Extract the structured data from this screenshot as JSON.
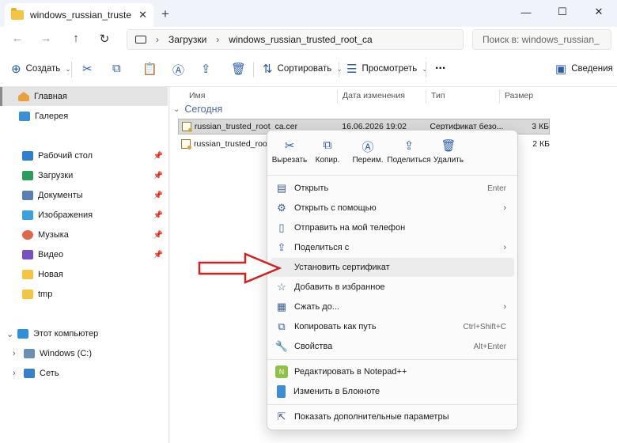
{
  "window": {
    "tab_title": "windows_russian_trusted_root_ca",
    "tab_close": "✕",
    "new_tab": "+",
    "minimize": "—",
    "maximize": "☐",
    "close": "✕"
  },
  "address": {
    "breadcrumb": [
      "Загрузки",
      "windows_russian_trusted_root_ca"
    ],
    "search_placeholder": "Поиск в: windows_russian_"
  },
  "command_bar": {
    "create_label": "Создать",
    "sort_label": "Сортировать",
    "view_label": "Просмотреть",
    "more_label": "...",
    "details_label": "Сведения"
  },
  "sidebar": {
    "items": [
      {
        "label": "Главная",
        "icon": "home-icon",
        "selected": true
      },
      {
        "label": "Галерея",
        "icon": "gallery-icon"
      },
      {
        "label": "Рабочий стол",
        "icon": "desktop-icon",
        "pinned": true
      },
      {
        "label": "Загрузки",
        "icon": "downloads-icon",
        "pinned": true
      },
      {
        "label": "Документы",
        "icon": "documents-icon",
        "pinned": true
      },
      {
        "label": "Изображения",
        "icon": "pictures-icon",
        "pinned": true
      },
      {
        "label": "Музыка",
        "icon": "music-icon",
        "pinned": true
      },
      {
        "label": "Видео",
        "icon": "video-icon",
        "pinned": true
      },
      {
        "label": "Новая",
        "icon": "folder-icon"
      },
      {
        "label": "tmp",
        "icon": "folder-icon"
      },
      {
        "label": "Этот компьютер",
        "icon": "computer-icon"
      },
      {
        "label": "Windows (C:)",
        "icon": "drive-icon"
      },
      {
        "label": "Сеть",
        "icon": "network-icon"
      }
    ]
  },
  "file_list": {
    "columns": [
      "Имя",
      "Дата изменения",
      "Тип",
      "Размер"
    ],
    "group": "Сегодня",
    "files": [
      {
        "name": "russian_trusted_root_ca.cer",
        "date": "16.06.2026 19:02",
        "type": "Сертификат безо...",
        "size": "3 КБ",
        "selected": true
      },
      {
        "name": "russian_trusted_root_c",
        "date": "",
        "type": "",
        "size": "2 КБ"
      }
    ]
  },
  "context_menu": {
    "quick_actions": [
      {
        "label": "Вырезать",
        "icon": "cut-icon"
      },
      {
        "label": "Копир.",
        "icon": "copy-icon"
      },
      {
        "label": "Переим.",
        "icon": "rename-icon"
      },
      {
        "label": "Поделиться",
        "icon": "share-icon"
      },
      {
        "label": "Удалить",
        "icon": "delete-icon"
      }
    ],
    "items": [
      {
        "label": "Открыть",
        "shortcut": "Enter",
        "icon": "open-icon"
      },
      {
        "label": "Открыть с помощью",
        "submenu": true,
        "icon": "open-with-icon"
      },
      {
        "label": "Отправить на мой телефон",
        "icon": "phone-icon"
      },
      {
        "label": "Поделиться с",
        "submenu": true,
        "icon": "share-with-icon"
      },
      {
        "label": "Установить сертификат",
        "highlighted": true,
        "icon": ""
      },
      {
        "label": "Добавить в избранное",
        "icon": "star-icon"
      },
      {
        "label": "Сжать до...",
        "submenu": true,
        "icon": "archive-icon"
      },
      {
        "label": "Копировать как путь",
        "shortcut": "Ctrl+Shift+C",
        "icon": "copy-path-icon"
      },
      {
        "label": "Свойства",
        "shortcut": "Alt+Enter",
        "icon": "wrench-icon"
      },
      {
        "label": "Редактировать в Notepad++",
        "icon": "notepadpp-icon"
      },
      {
        "label": "Изменить в Блокноте",
        "icon": "notepad-icon"
      },
      {
        "label": "Показать дополнительные параметры",
        "icon": "more-options-icon"
      }
    ]
  },
  "colors": {
    "accent": "#2a5caa",
    "arrow": "#d42020",
    "folder": "#f5c542"
  }
}
